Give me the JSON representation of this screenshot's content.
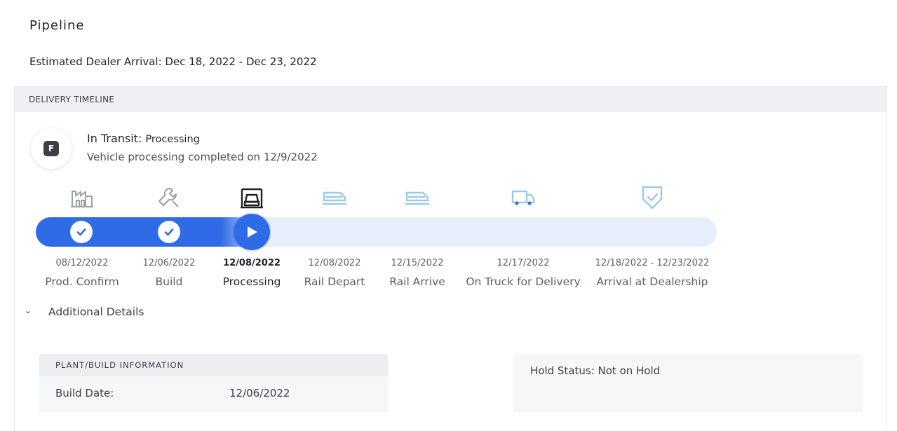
{
  "page": {
    "title": "Pipeline",
    "eta": "Estimated Dealer Arrival: Dec 18, 2022 - Dec 23, 2022"
  },
  "timeline": {
    "header": "DELIVERY TIMELINE",
    "avatar_letter": "F",
    "status_label": "In Transit: ",
    "status_value": "Processing",
    "status_detail": "Vehicle processing completed on 12/9/2022",
    "progress_fraction": 0.34,
    "colors": {
      "accent": "#2f6be6",
      "track": "#e7edfb",
      "done_icon": "#9aa0a6",
      "future_icon": "#9ccbe8",
      "active_icon": "#1f2328"
    },
    "steps": [
      {
        "date": "08/12/2022",
        "label": "Prod. Confirm",
        "icon": "factory-icon",
        "state": "complete"
      },
      {
        "date": "12/06/2022",
        "label": "Build",
        "icon": "wrench-icon",
        "state": "complete"
      },
      {
        "date": "12/08/2022",
        "label": "Processing",
        "icon": "car-lift-icon",
        "state": "current"
      },
      {
        "date": "12/08/2022",
        "label": "Rail Depart",
        "icon": "train-icon",
        "state": "upcoming"
      },
      {
        "date": "12/15/2022",
        "label": "Rail Arrive",
        "icon": "train-icon",
        "state": "upcoming"
      },
      {
        "date": "12/17/2022",
        "label": "On Truck for Delivery",
        "icon": "truck-icon",
        "state": "upcoming"
      },
      {
        "date": "12/18/2022 - 12/23/2022",
        "label": "Arrival at Dealership",
        "icon": "shield-check-icon",
        "state": "upcoming"
      }
    ]
  },
  "details": {
    "toggle_label": "Additional Details",
    "chevron_icon": "chevron-down-icon",
    "plant": {
      "header": "PLANT/BUILD INFORMATION",
      "build_date_label": "Build Date:",
      "build_date_value": "12/06/2022"
    },
    "hold_status": "Hold Status: Not on Hold"
  }
}
